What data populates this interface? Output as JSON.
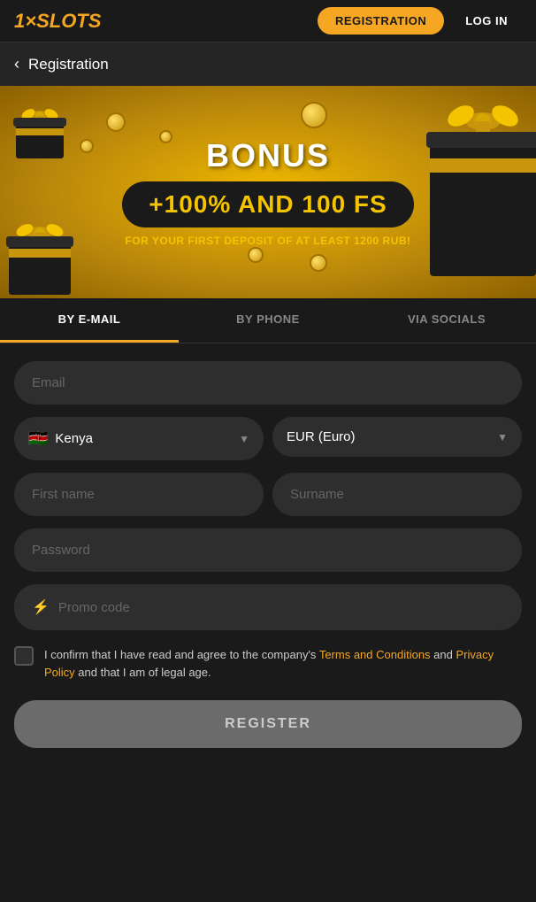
{
  "header": {
    "logo": "1×SLOTS",
    "register_btn": "REGISTRATION",
    "login_btn": "LOG IN"
  },
  "nav": {
    "back_label": "Registration"
  },
  "banner": {
    "bonus_label": "BONUS",
    "bonus_amount": "+100% AND 100 FS",
    "bonus_description": "FOR YOUR FIRST DEPOSIT OF AT LEAST 1200 RUB!"
  },
  "tabs": [
    {
      "id": "email",
      "label": "BY E-MAIL",
      "active": true
    },
    {
      "id": "phone",
      "label": "BY PHONE",
      "active": false
    },
    {
      "id": "socials",
      "label": "VIA SOCIALS",
      "active": false
    }
  ],
  "form": {
    "email_placeholder": "Email",
    "country": {
      "flag": "🇰🇪",
      "name": "Kenya"
    },
    "currency": {
      "name": "EUR (Euro)"
    },
    "first_name_placeholder": "First name",
    "surname_placeholder": "Surname",
    "password_placeholder": "Password",
    "promo_placeholder": "Promo code",
    "promo_icon": "⚡",
    "checkbox_text_before": "I confirm that I have read and agree to the company's ",
    "terms_label": "Terms and Conditions",
    "checkbox_text_middle": " and ",
    "privacy_label": "Privacy Policy",
    "checkbox_text_after": " and that I am of legal age.",
    "register_btn": "REGISTER"
  }
}
